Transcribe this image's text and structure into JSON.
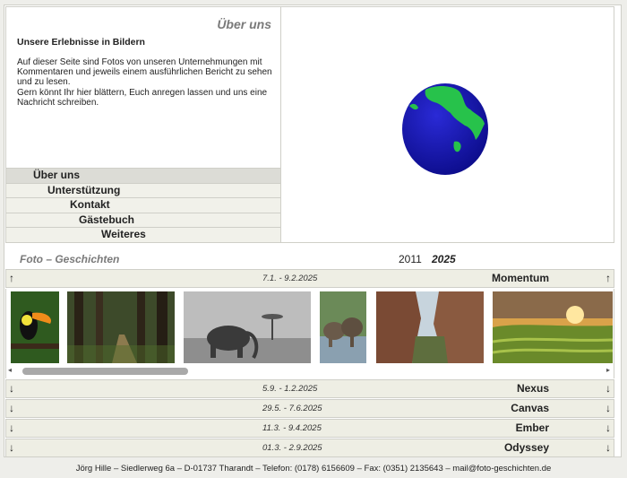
{
  "header": {
    "title": "Über uns",
    "subtitle": "Unsere Erlebnisse in Bildern",
    "intro": [
      "Auf dieser Seite sind Fotos von unseren Unternehmungen mit Kommentaren und jeweils einem ausführlichen Bericht zu sehen und zu lesen.",
      "Gern könnt Ihr hier blättern, Euch anregen lassen und uns eine Nachricht schreiben."
    ]
  },
  "nav": [
    "Über uns",
    "Unterstützung",
    "Kontakt",
    "Gästebuch",
    "Weiteres"
  ],
  "section": {
    "title": "Foto – Geschichten",
    "years": [
      "2011",
      "2025"
    ]
  },
  "stories": [
    {
      "date": "7.1. - 9.2.2025",
      "name": "Momentum",
      "arrow": "↑",
      "expanded": true
    },
    {
      "date": "5.9. - 1.2.2025",
      "name": "Nexus",
      "arrow": "↓"
    },
    {
      "date": "29.5. - 7.6.2025",
      "name": "Canvas",
      "arrow": "↓"
    },
    {
      "date": "11.3. - 9.4.2025",
      "name": "Ember",
      "arrow": "↓"
    },
    {
      "date": "01.3. - 2.9.2025",
      "name": "Odyssey",
      "arrow": "↓"
    }
  ],
  "photos": [
    "toucan",
    "forest path",
    "elephant",
    "elephants at water",
    "canyon",
    "rice terraces at sunset"
  ],
  "scrollbar": {
    "left": "◂",
    "right": "▸"
  },
  "footer": "Jörg Hille – Siedlerweg 6a – D-01737 Tharandt – Telefon: (0178) 6156609 – Fax: (0351) 2135643 – mail@foto-geschichten.de",
  "colors": {
    "ocean": "#1a1ab8",
    "land": "#27c24b",
    "nav_active": "#dcdcd6"
  }
}
